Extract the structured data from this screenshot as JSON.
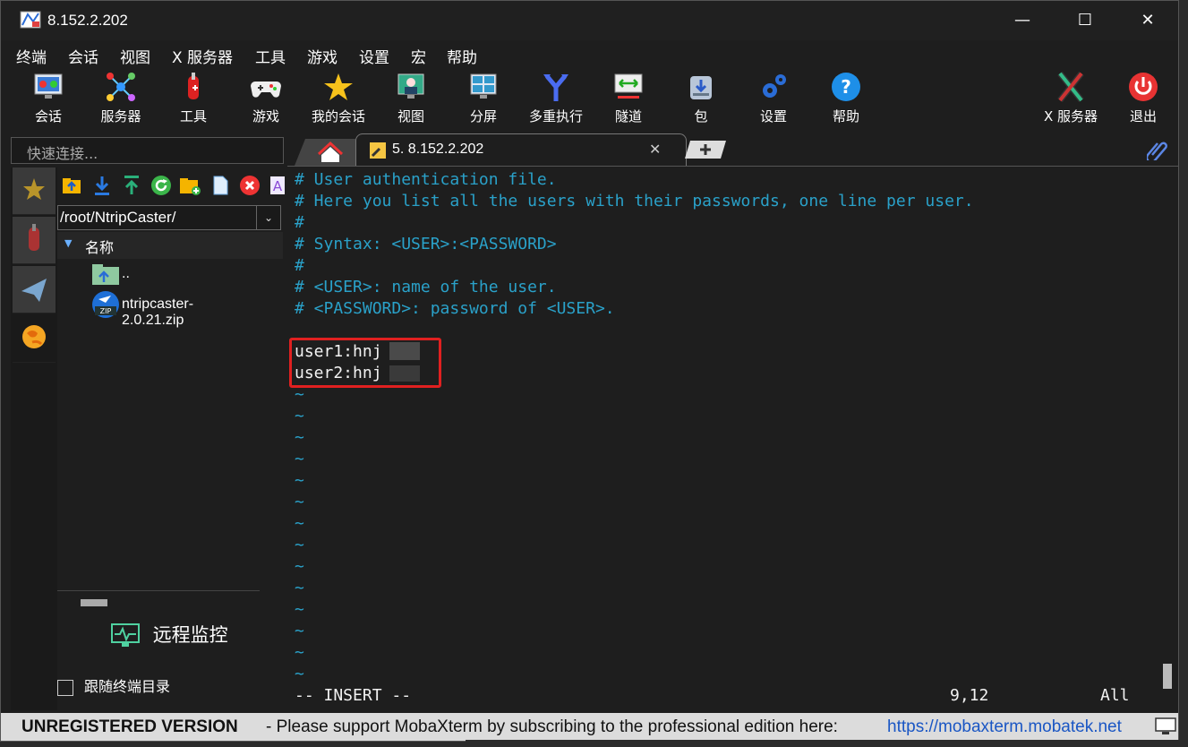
{
  "window": {
    "title": "8.152.2.202",
    "minimize": "—",
    "maximize": "☐",
    "close": "✕"
  },
  "menu": [
    "终端",
    "会话",
    "视图",
    "X 服务器",
    "工具",
    "游戏",
    "设置",
    "宏",
    "帮助"
  ],
  "toolbar": {
    "items": [
      "会话",
      "服务器",
      "工具",
      "游戏",
      "我的会话",
      "视图",
      "分屏",
      "多重执行",
      "隧道",
      "包",
      "设置",
      "帮助"
    ],
    "right_items": [
      "X 服务器",
      "退出"
    ]
  },
  "quick_connect": {
    "placeholder": "快速连接..."
  },
  "sftp": {
    "path": "/root/NtripCaster/",
    "column_header": "名称",
    "files": [
      "..",
      "ntripcaster-2.0.21.zip"
    ],
    "remote_monitor": "远程监控",
    "follow_terminal": "跟随终端目录"
  },
  "tabs": {
    "active_label": "5. 8.152.2.202",
    "close": "✕",
    "new": "+"
  },
  "terminal": {
    "lines": [
      "# User authentication file.",
      "# Here you list all the users with their passwords, one line per user.",
      "#",
      "# Syntax: <USER>:<PASSWORD>",
      "#",
      "# <USER>: name of the user.",
      "# <PASSWORD>: password of <USER>.",
      "",
      "user1:hnj",
      "user2:hnj"
    ],
    "tilde": "~",
    "mode": "-- INSERT --",
    "position": "9,12",
    "scroll": "All"
  },
  "status_bar": {
    "bold": "UNREGISTERED VERSION",
    "message": "-  Please support MobaXterm by subscribing to the professional edition here:",
    "link": "https://mobaxterm.mobatek.net"
  },
  "colors": {
    "comment": "#2aa1c9",
    "highlight_box": "#e02020",
    "link": "#1a56c4"
  }
}
